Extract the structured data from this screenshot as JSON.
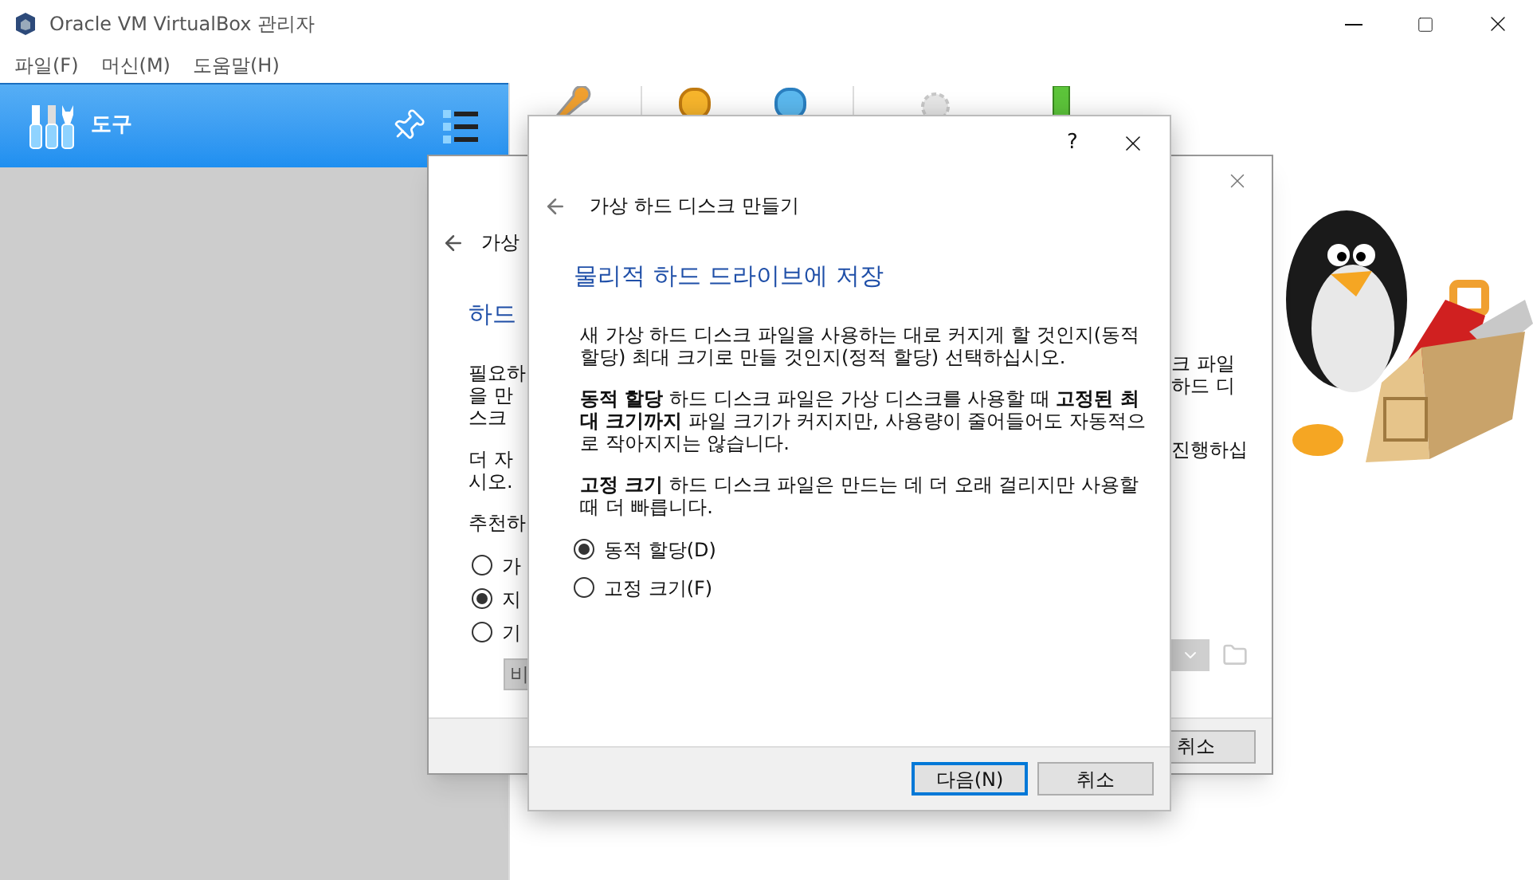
{
  "window": {
    "title": "Oracle VM VirtualBox 관리자"
  },
  "menu": [
    "파일(F)",
    "머신(M)",
    "도움말(H)"
  ],
  "sidebar": {
    "tools_label": "도구"
  },
  "background_dialog": {
    "back_title": "가상",
    "heading": "하드",
    "left_lines": [
      [
        "필요하",
        "을 만",
        "스크"
      ],
      [
        "더 자",
        "시오."
      ],
      [
        "추천하"
      ]
    ],
    "radios": [
      {
        "label": "가",
        "selected": false
      },
      {
        "label": "지",
        "selected": true
      },
      {
        "label": "기",
        "selected": false
      }
    ],
    "combo_text": "비",
    "right_lines": [
      [
        "크 파일",
        "하드 디"
      ],
      [
        "진행하십"
      ]
    ],
    "cancel": "취소"
  },
  "dialog": {
    "help": "?",
    "title": "가상 하드 디스크 만들기",
    "heading": "물리적 하드 드라이브에 저장",
    "paragraphs": [
      "새 가상 하드 디스크 파일을 사용하는 대로 커지게 할 것인지(동적 할당) 최대 크기로 만들 것인지(정적 할당) 선택하십시오.",
      "**동적 할당** 하드 디스크 파일은 가상 디스크를 사용할 때 **고정된 최대 크기까지** 파일 크기가 커지지만, 사용량이 줄어들어도 자동적으로 작아지지는 않습니다.",
      "**고정 크기** 하드 디스크 파일은 만드는 데 더 오래 걸리지만 사용할 때 더 빠릅니다."
    ],
    "options": [
      {
        "label": "동적 할당(D)",
        "selected": true
      },
      {
        "label": "고정 크기(F)",
        "selected": false
      }
    ],
    "buttons": [
      {
        "label": "다음(N)",
        "focused": true
      },
      {
        "label": "취소",
        "focused": false
      }
    ]
  }
}
